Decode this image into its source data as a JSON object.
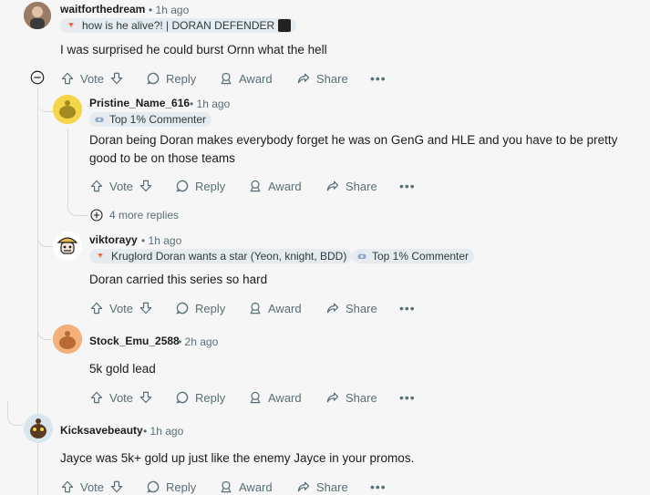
{
  "colors": {
    "accent": "#d93a00",
    "muted": "#576f76",
    "flair_bg": "#e5ebee",
    "thread_line": "#d8dadc"
  },
  "actions": {
    "vote": "Vote",
    "reply": "Reply",
    "award": "Award",
    "share": "Share",
    "more": "•••"
  },
  "comments": [
    {
      "username": "waitforthedream",
      "time": "1h ago",
      "flair": "how is he alive?! | DORAN DEFENDER",
      "body": "I was surprised he could burst Ornn what the hell"
    },
    {
      "username": "Pristine_Name_616",
      "time": "1h ago",
      "flair": "Top 1% Commenter",
      "body": "Doran being Doran makes everybody forget he was on GenG and HLE and you have to be pretty good to be on those teams",
      "more_replies": "4 more replies"
    },
    {
      "username": "viktorayy",
      "time": "1h ago",
      "flair": "Kruglord Doran wants a star (Yeon, knight, BDD)",
      "flair2": "Top 1% Commenter",
      "body": "Doran carried this series so hard"
    },
    {
      "username": "Stock_Emu_2588",
      "time": "2h ago",
      "body": "5k gold lead"
    },
    {
      "username": "Kicksavebeauty",
      "time": "1h ago",
      "body": "Jayce was 5k+ gold up just like the enemy Jayce in your promos."
    }
  ]
}
